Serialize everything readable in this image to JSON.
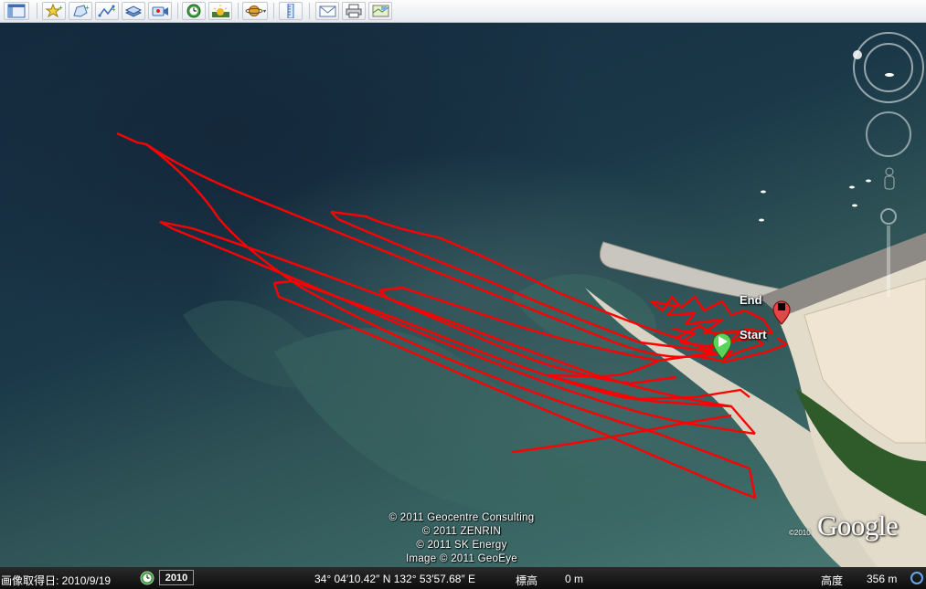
{
  "toolbar": {
    "buttons": [
      {
        "name": "sidebar-toggle-icon"
      },
      {
        "name": "add-placemark-icon"
      },
      {
        "name": "add-polygon-icon"
      },
      {
        "name": "add-path-icon"
      },
      {
        "name": "add-image-overlay-icon"
      },
      {
        "name": "record-tour-icon"
      },
      {
        "name": "historical-imagery-icon"
      },
      {
        "name": "sunlight-icon"
      },
      {
        "name": "switch-planet-icon"
      },
      {
        "name": "ruler-icon"
      },
      {
        "name": "email-icon"
      },
      {
        "name": "print-icon"
      },
      {
        "name": "view-in-maps-icon"
      }
    ]
  },
  "map": {
    "start_label": "Start",
    "end_label": "End",
    "credits": [
      "© 2011 Geocentre Consulting",
      "© 2011 ZENRIN",
      "© 2011 SK Energy",
      "Image © 2011 GeoEye"
    ],
    "google_logo": "Google",
    "logo_year": "©2010",
    "track_color": "#ff0000"
  },
  "status": {
    "imagery_date_label": "画像取得日: 2010/9/19",
    "year": "2010",
    "coordinates": "34° 04′10.42″ N 132° 53′57.68″ E",
    "elevation_label": "標高",
    "elevation_value": "0 m",
    "altitude_label": "高度",
    "altitude_value": "356 m"
  }
}
